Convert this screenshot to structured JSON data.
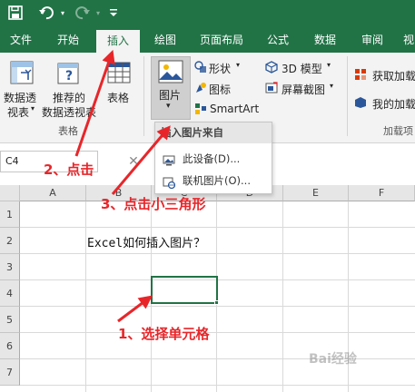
{
  "colors": {
    "excel_green": "#217346",
    "annotation_red": "#e8262a"
  },
  "quick_access": {
    "save_icon": "save-icon",
    "undo_icon": "undo-icon",
    "redo_icon": "redo-icon",
    "customize_icon": "customize-icon"
  },
  "tabs": [
    "文件",
    "开始",
    "插入",
    "绘图",
    "页面布局",
    "公式",
    "数据",
    "审阅",
    "视"
  ],
  "active_tab": "插入",
  "ribbon": {
    "pivot_table": {
      "line1": "数据透",
      "line2": "视表"
    },
    "recommended_pivot": {
      "line1": "推荐的",
      "line2": "数据透视表"
    },
    "table": "表格",
    "tables_group": "表格",
    "picture": "图片",
    "shapes": "形状",
    "icons": "图标",
    "smartart": "SmartArt",
    "model3d": "3D 模型",
    "screenshot": "屏幕截图",
    "get_addins": "获取加载",
    "my_addins": "我的加载",
    "addins_group": "加载项"
  },
  "dropdown": {
    "header": "插入图片来自",
    "items": [
      "此设备(D)...",
      "联机图片(O)..."
    ]
  },
  "name_box": "C4",
  "columns": [
    "A",
    "B",
    "C",
    "D",
    "E",
    "F"
  ],
  "rows": [
    "1",
    "2",
    "3",
    "4",
    "5",
    "6",
    "7"
  ],
  "cells": {
    "B2": "Excel如何插入图片？"
  },
  "annotations": {
    "step1": "1、选择单元格",
    "step2": "2、点击",
    "step3": "3、点击小三角形"
  },
  "watermark": "Bai经验"
}
